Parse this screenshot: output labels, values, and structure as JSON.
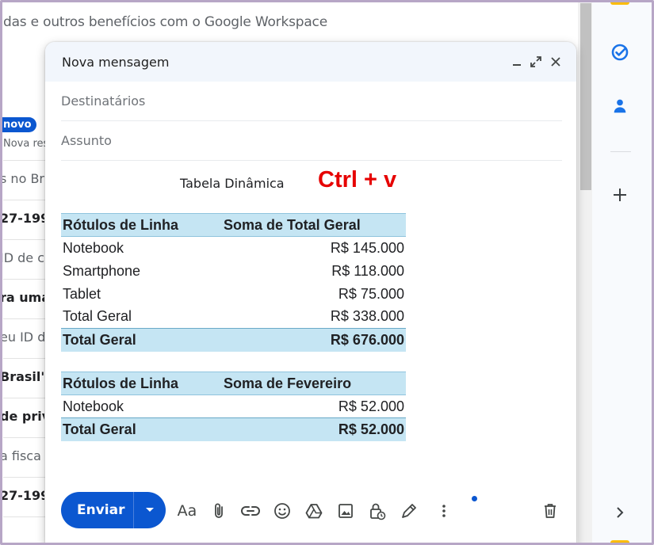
{
  "background": {
    "banner": "das e outros benefícios com o Google Workspace",
    "badge": "novo",
    "badge_sub": "Nova res",
    "rows": [
      {
        "text": "s no Br",
        "style": "light"
      },
      {
        "text": "27-199",
        "style": "bold"
      },
      {
        "text": "ID de c",
        "style": "light"
      },
      {
        "text": "ra uma",
        "style": "bold"
      },
      {
        "text": "eu ID de",
        "style": "light"
      },
      {
        "text": "Brasil\"",
        "style": "bold"
      },
      {
        "text": "de priv",
        "style": "bold"
      },
      {
        "text": "a fisca",
        "style": "light"
      },
      {
        "text": "27-199",
        "style": "bold"
      }
    ]
  },
  "compose": {
    "title": "Nova mensagem",
    "to_placeholder": "Destinatários",
    "subject_placeholder": "Assunto",
    "pivot_label": "Tabela Dinâmica",
    "overlay_text": "Ctrl + v",
    "table1": {
      "headers": [
        "Rótulos de Linha",
        "Soma de Total Geral"
      ],
      "rows": [
        [
          "Notebook",
          "R$ 145.000"
        ],
        [
          "Smartphone",
          "R$ 118.000"
        ],
        [
          "Tablet",
          "R$ 75.000"
        ],
        [
          "Total Geral",
          "R$ 338.000"
        ]
      ],
      "total": [
        "Total Geral",
        "R$ 676.000"
      ]
    },
    "table2": {
      "headers": [
        "Rótulos de Linha",
        "Soma de Fevereiro"
      ],
      "rows": [
        [
          "Notebook",
          "R$ 52.000"
        ]
      ],
      "total": [
        "Total Geral",
        "R$ 52.000"
      ]
    },
    "send_label": "Enviar",
    "format_label": "Aa"
  },
  "colors": {
    "accent": "#0b57d0",
    "table_header": "#c5e5f3",
    "overlay_red": "#e60000"
  }
}
